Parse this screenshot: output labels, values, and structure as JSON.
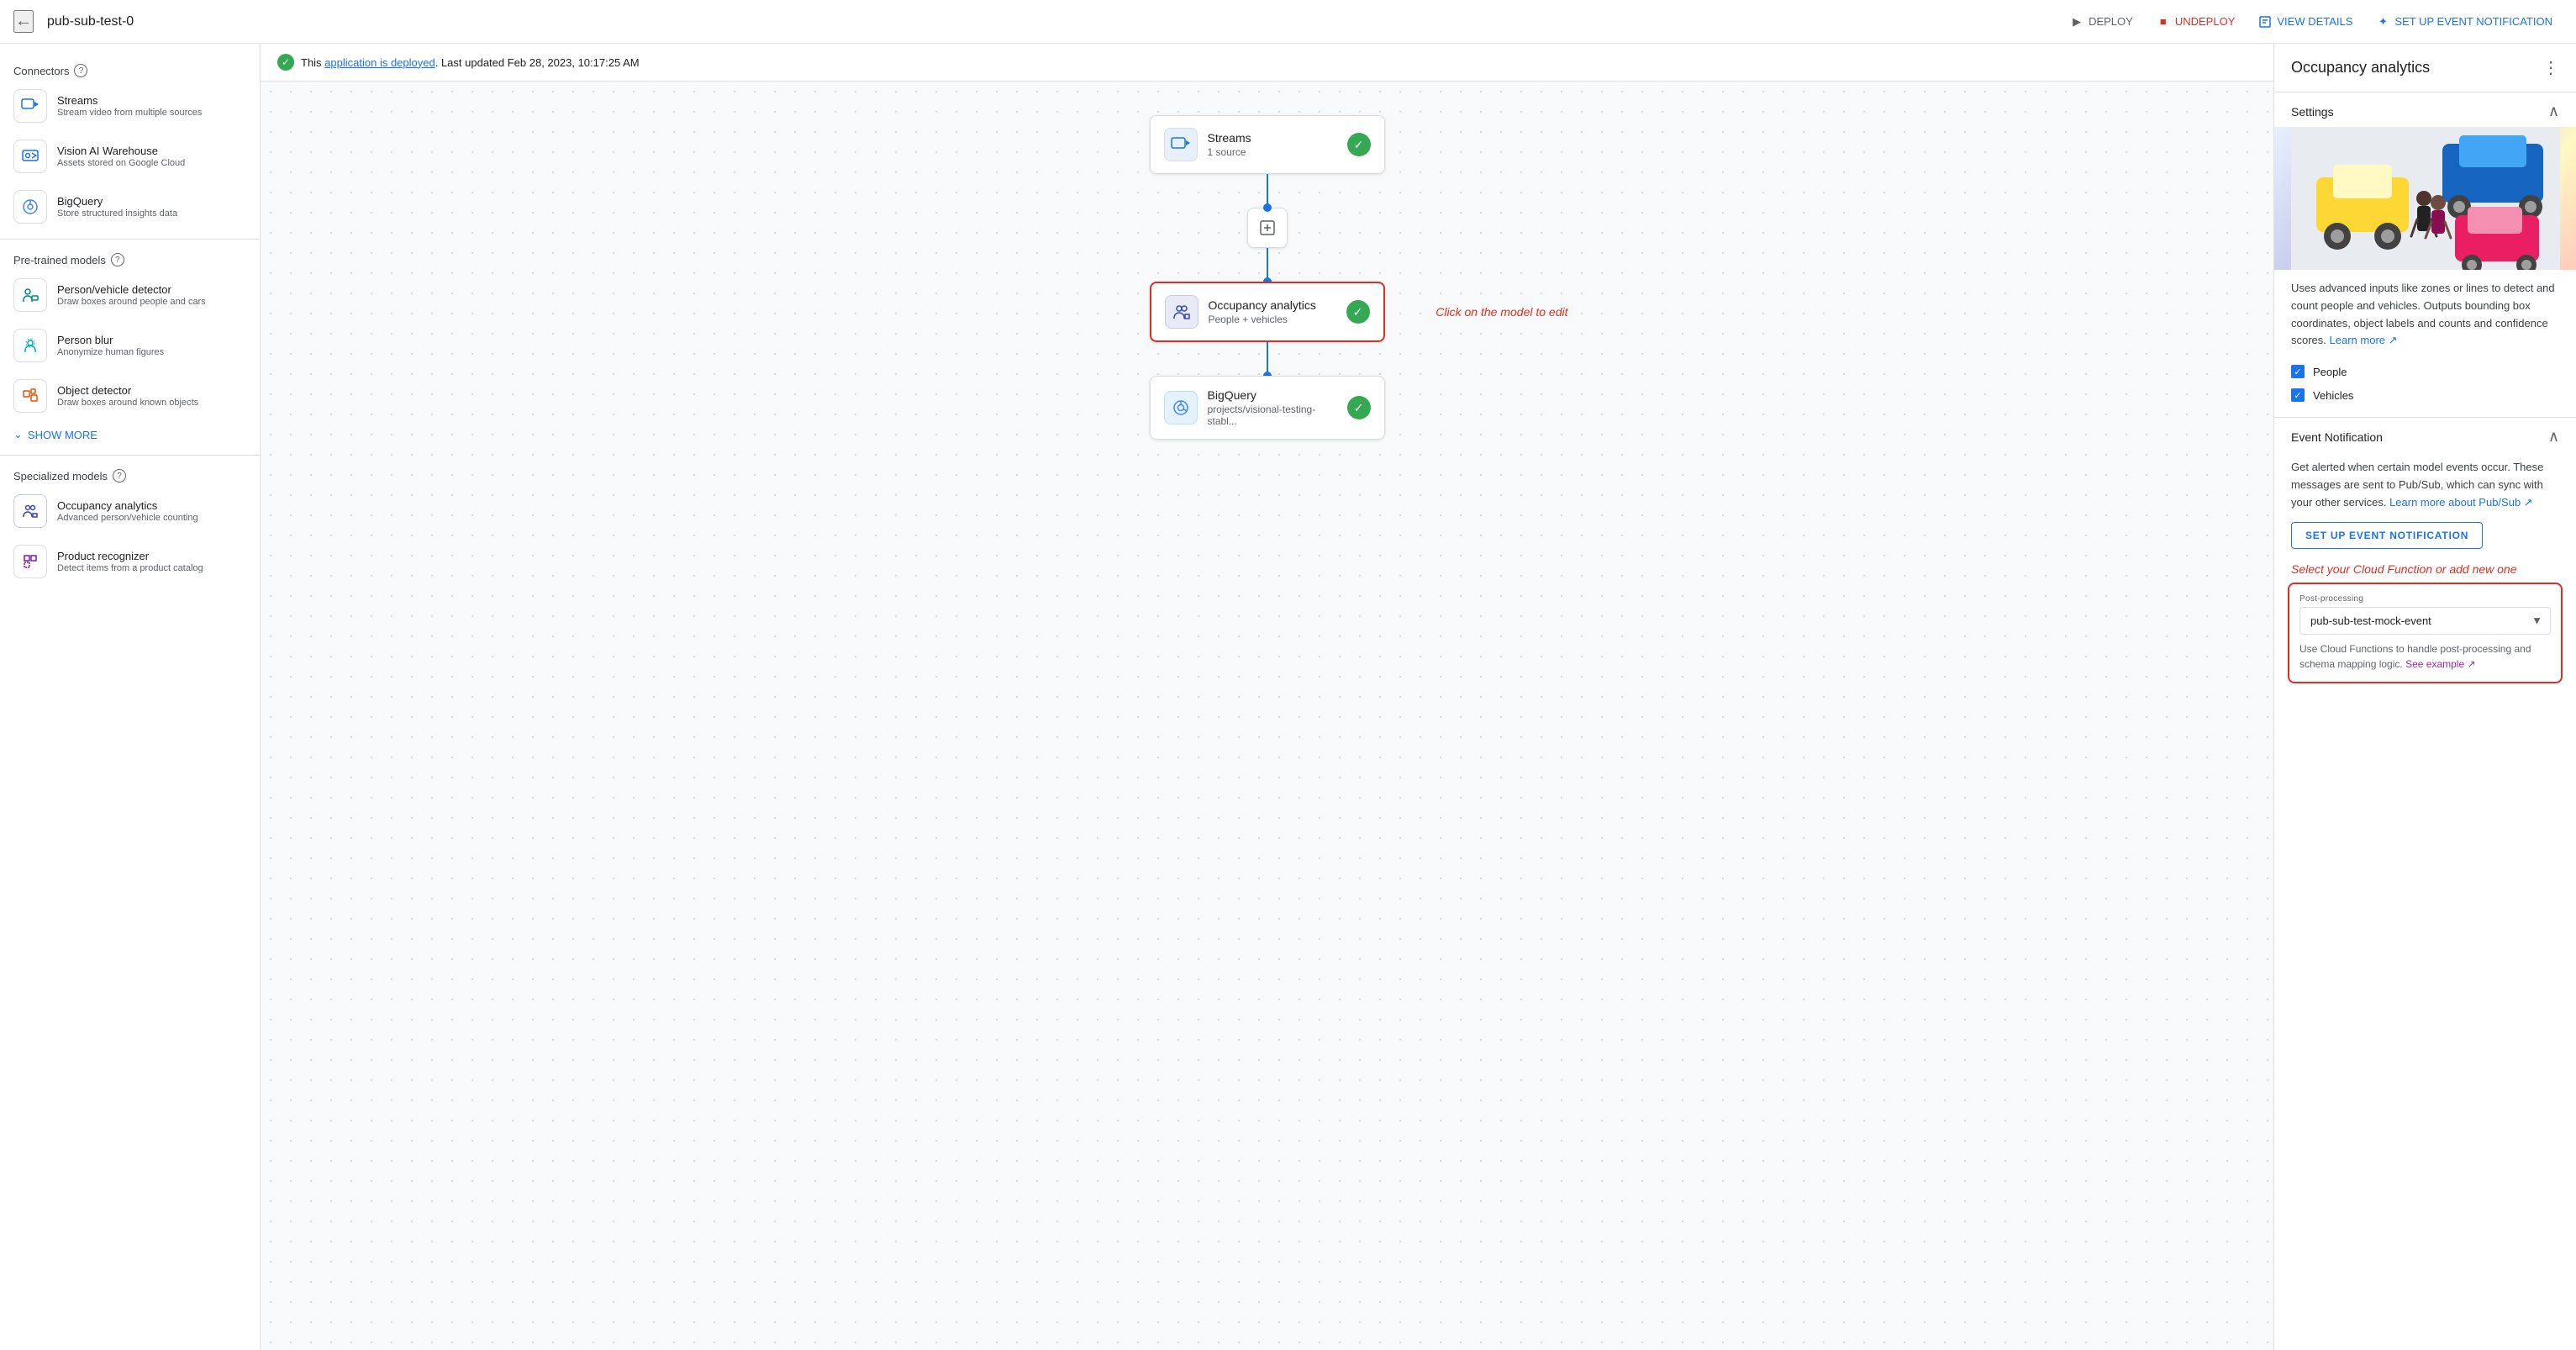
{
  "topbar": {
    "back_icon": "←",
    "title": "pub-sub-test-0",
    "deploy_label": "DEPLOY",
    "undeploy_label": "UNDEPLOY",
    "view_details_label": "VIEW DETAILS",
    "setup_event_label": "SET UP EVENT NOTIFICATION"
  },
  "status_bar": {
    "message_prefix": "This ",
    "link_text": "application is deployed",
    "message_suffix": ". Last updated Feb 28, 2023, 10:17:25 AM"
  },
  "sidebar": {
    "connectors_title": "Connectors",
    "connectors": [
      {
        "name": "Streams",
        "desc": "Stream video from multiple sources"
      },
      {
        "name": "Vision AI Warehouse",
        "desc": "Assets stored on Google Cloud"
      },
      {
        "name": "BigQuery",
        "desc": "Store structured insights data"
      }
    ],
    "pretrained_title": "Pre-trained models",
    "pretrained": [
      {
        "name": "Person/vehicle detector",
        "desc": "Draw boxes around people and cars"
      },
      {
        "name": "Person blur",
        "desc": "Anonymize human figures"
      },
      {
        "name": "Object detector",
        "desc": "Draw boxes around known objects"
      }
    ],
    "show_more_label": "SHOW MORE",
    "specialized_title": "Specialized models",
    "specialized": [
      {
        "name": "Occupancy analytics",
        "desc": "Advanced person/vehicle counting"
      },
      {
        "name": "Product recognizer",
        "desc": "Detect items from a product catalog"
      }
    ]
  },
  "canvas": {
    "nodes": [
      {
        "id": "streams",
        "name": "Streams",
        "sub": "1 source"
      },
      {
        "id": "occupancy",
        "name": "Occupancy analytics",
        "sub": "People + vehicles",
        "selected": true
      },
      {
        "id": "bigquery",
        "name": "BigQuery",
        "sub": "projects/visional-testing-stabl..."
      }
    ],
    "click_hint": "Click on the model to edit"
  },
  "right_panel": {
    "title": "Occupancy analytics",
    "settings_label": "Settings",
    "description": "Uses advanced inputs like zones or lines to detect and count people and vehicles. Outputs bounding box coordinates, object labels and counts and confidence scores.",
    "learn_more_label": "Learn more",
    "checkboxes": [
      {
        "label": "People",
        "checked": true
      },
      {
        "label": "Vehicles",
        "checked": true
      }
    ],
    "event_notification_label": "Event Notification",
    "event_desc": "Get alerted when certain model events occur. These messages are sent to Pub/Sub, which can sync with your other services.",
    "event_learn_more": "Learn more about Pub/Sub",
    "setup_btn_label": "SET UP EVENT NOTIFICATION",
    "select_hint": "Select your Cloud Function or add new one",
    "post_processing_label": "Post-processing",
    "post_processing_value": "pub-sub-test-mock-event",
    "post_processing_desc": "Use Cloud Functions to handle post-processing and schema mapping logic.",
    "see_example_label": "See example"
  }
}
